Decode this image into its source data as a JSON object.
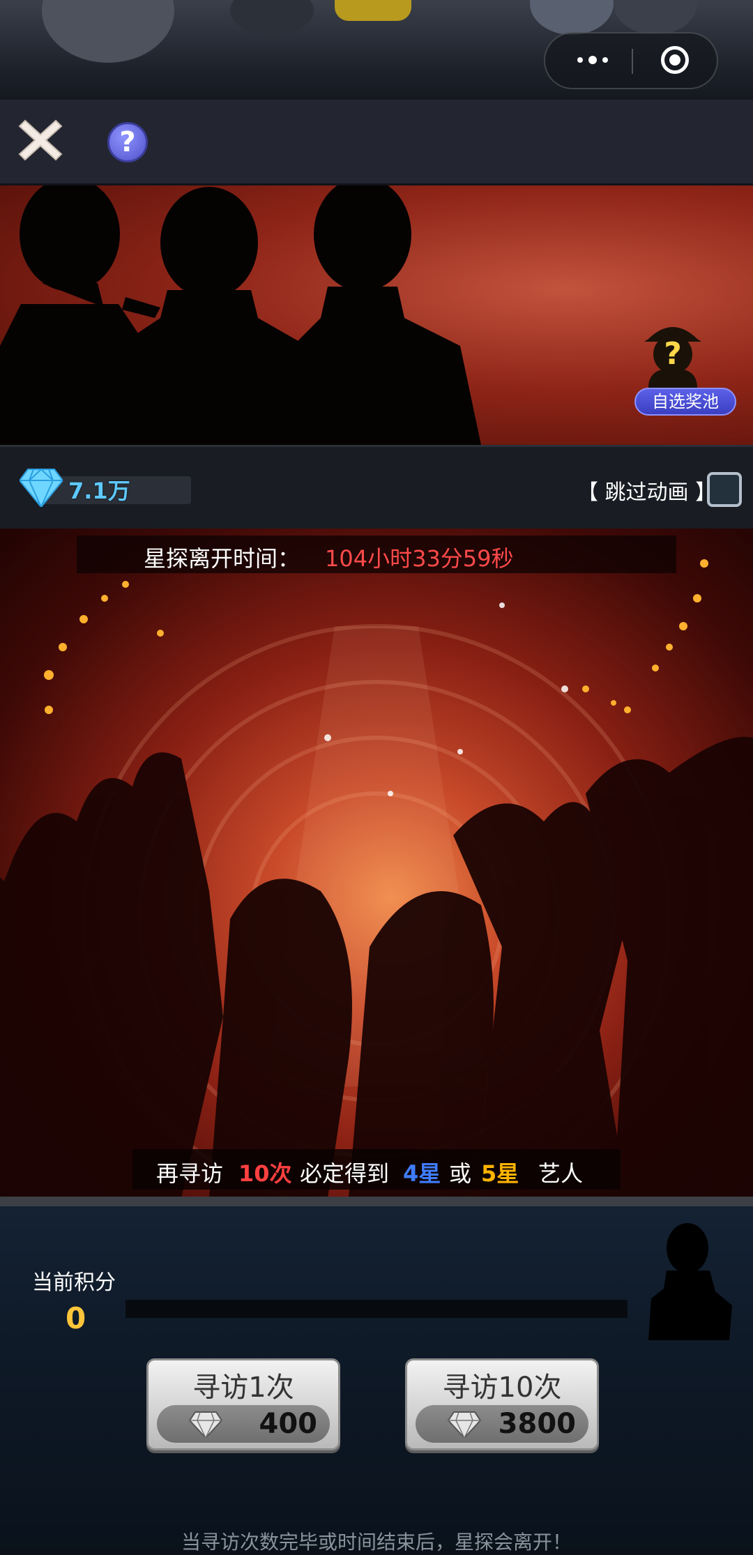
{
  "toolbar": {
    "close_icon": "close-icon",
    "help_icon_text": "?"
  },
  "banner": {
    "pool_label": "自选奖池"
  },
  "resources": {
    "gem_count": "7.1万",
    "skip_label": "【 跳过动画 】",
    "skip_checked": false
  },
  "stage": {
    "timer_label": "星探离开时间：",
    "timer_value": "104小时33分59秒",
    "guarantee": {
      "prefix": "再寻访",
      "count": "10次",
      "middle": "必定得到",
      "star4": "4星",
      "or": "或",
      "star5": "5星",
      "suffix": "艺人"
    }
  },
  "bottom": {
    "score_label": "当前积分",
    "score_value": "0",
    "score_progress": 0,
    "draw_once": {
      "label": "寻访1次",
      "cost": "400"
    },
    "draw_ten": {
      "label": "寻访10次",
      "cost": "3800"
    },
    "footer_note": "当寻访次数完毕或时间结束后，星探会离开！"
  },
  "colors": {
    "accent_red": "#ff4a4a",
    "star4_blue": "#3f7dff",
    "star5_gold": "#ffb400",
    "gem_blue": "#5ec8ff",
    "score_gold": "#ffc53a"
  }
}
